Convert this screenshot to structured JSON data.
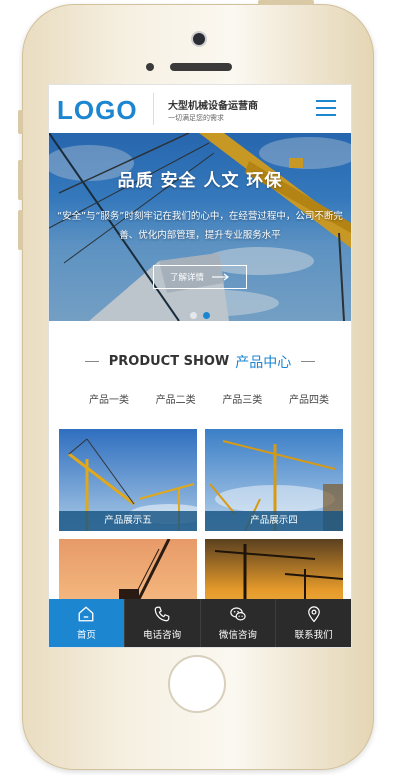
{
  "header": {
    "logo": "LOGO",
    "brand_name": "大型机械设备运营商",
    "brand_sub": "一切满足您的需求"
  },
  "banner": {
    "title": "品质 安全 人文 环保",
    "description": "“安全”与“服务”时刻牢记在我们的心中，在经营过程中，公司不断完善、优化内部管理，提升专业服务水平",
    "button_label": "了解详情",
    "slide_count": 2,
    "active_slide": 2
  },
  "section": {
    "title_en": "PRODUCT SHOW",
    "title_cn": "产品中心"
  },
  "categories": [
    "产品一类",
    "产品二类",
    "产品三类",
    "产品四类"
  ],
  "products": [
    {
      "label": "产品展示五",
      "scene": "crane-blue-sky"
    },
    {
      "label": "产品展示四",
      "scene": "cranes-blue-sky"
    },
    {
      "label": "",
      "scene": "crane-sunset"
    },
    {
      "label": "",
      "scene": "cranes-sunset"
    }
  ],
  "bottom_nav": [
    {
      "label": "首页",
      "icon": "home-icon",
      "active": true
    },
    {
      "label": "电话咨询",
      "icon": "phone-icon",
      "active": false
    },
    {
      "label": "微信咨询",
      "icon": "wechat-icon",
      "active": false
    },
    {
      "label": "联系我们",
      "icon": "location-icon",
      "active": false
    }
  ],
  "colors": {
    "accent": "#1c86d1",
    "nav_bg": "#2b2b2b",
    "card_label_bg": "#165482"
  }
}
